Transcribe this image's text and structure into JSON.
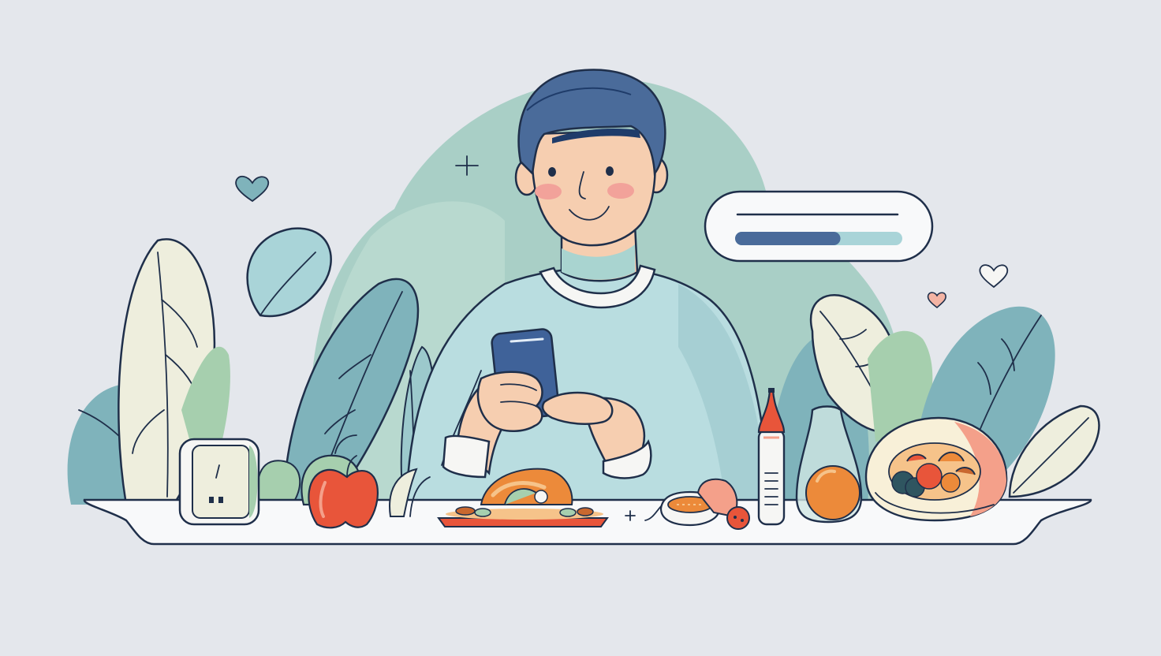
{
  "colors": {
    "background": "#e4e7ec",
    "blob": "#a9cfc6",
    "leaf_teal": "#7fb3bb",
    "leaf_cream": "#eeeedd",
    "leaf_green": "#a6cfae",
    "sweater": "#b9dde0",
    "skin": "#f6ceb0",
    "hair": "#4a6b9a",
    "outline": "#1f2f4a",
    "accent_red": "#e8553a",
    "accent_orange": "#ec8a3a",
    "phone": "#3f6299"
  },
  "progress_card": {
    "value": 0.63
  },
  "icons": [
    "heart-icon",
    "sparkle-icon",
    "plus-icon"
  ]
}
